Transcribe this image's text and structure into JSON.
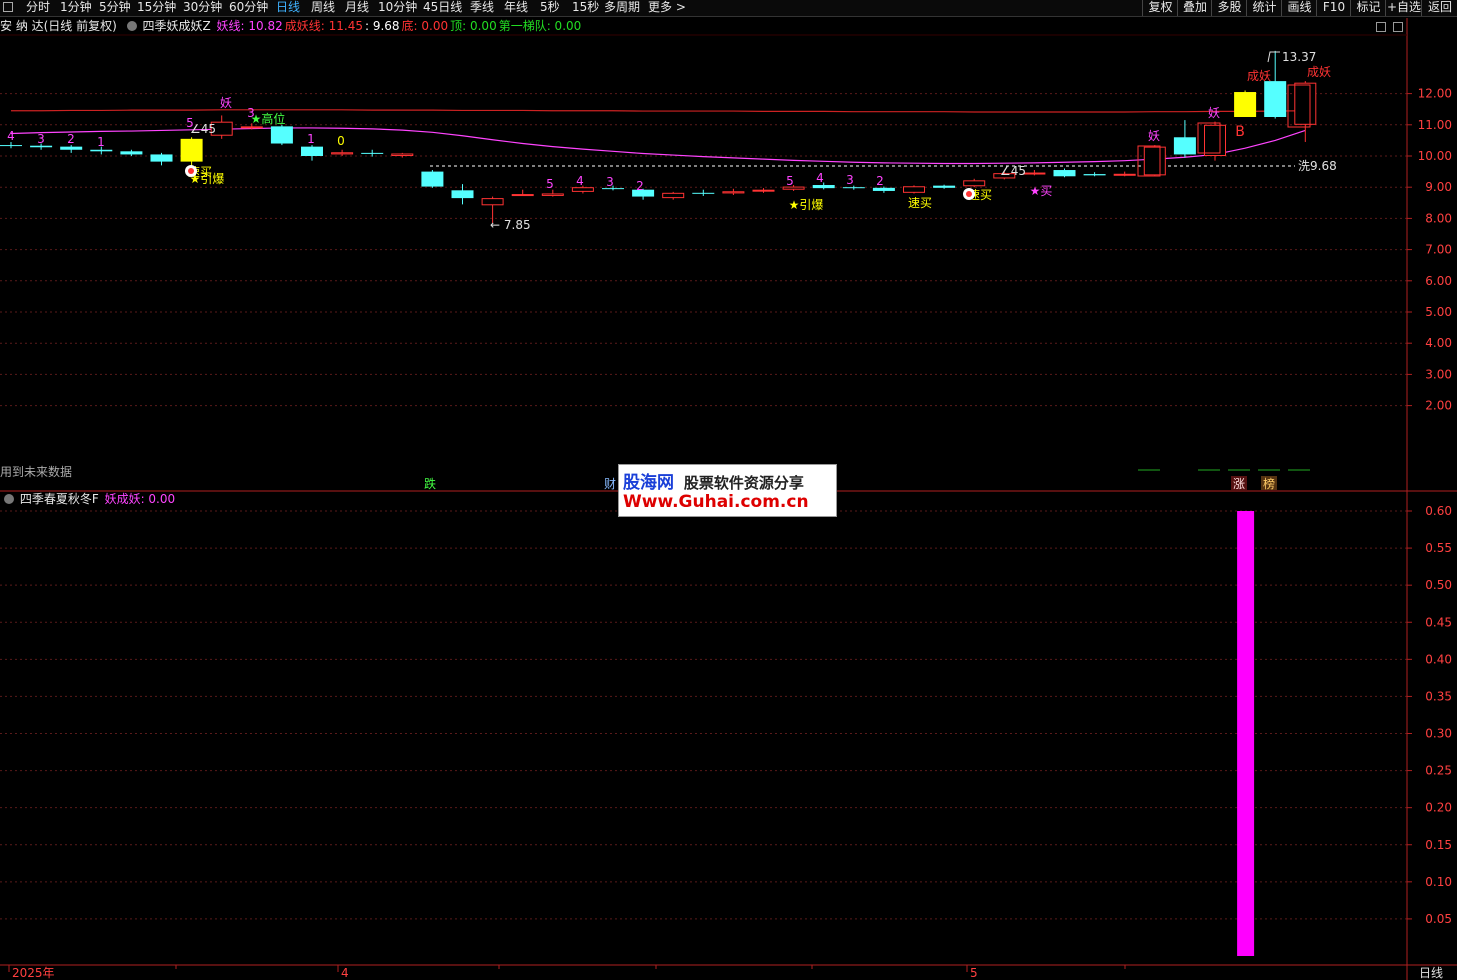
{
  "toolbar": {
    "items": [
      "分时",
      "1分钟",
      "5分钟",
      "15分钟",
      "30分钟",
      "60分钟",
      "日线",
      "周线",
      "月线",
      "10分钟",
      "45日线",
      "季线",
      "年线",
      "5秒",
      "15秒",
      "多周期",
      "更多 >"
    ],
    "active_index": 6,
    "right_items": [
      "复权",
      "叠加",
      "多股",
      "统计",
      "画线",
      "F10",
      "标记",
      "+自选",
      "返回"
    ]
  },
  "main_legend": {
    "stock_name": "安 纳 达(日线 前复权)",
    "indicator_name": "四季妖成妖Z",
    "items": [
      {
        "label": "妖线: 10.82",
        "color": "#ff44ff"
      },
      {
        "label": "成妖线: 11.45",
        "color": "#ff3333"
      },
      {
        "label": ": 9.68",
        "color": "#ffffff"
      },
      {
        "label": "底: 0.00",
        "color": "#ff3333"
      },
      {
        "label": "顶: 0.00",
        "color": "#22dd22"
      },
      {
        "label": "第一梯队: 0.00",
        "color": "#22dd22"
      }
    ]
  },
  "sub_legend": {
    "indicator_name": "四季春夏秋冬F",
    "items": [
      {
        "label": "妖成妖: 0.00",
        "color": "#ff44ff"
      }
    ]
  },
  "future_data_note": "用到未来数据",
  "main_axis": {
    "ticks": [
      "12.00",
      "11.00",
      "10.00",
      "9.00",
      "8.00",
      "7.00",
      "6.00",
      "5.00",
      "4.00",
      "3.00",
      "2.00"
    ]
  },
  "sub_axis": {
    "ticks": [
      "0.60",
      "0.55",
      "0.50",
      "0.45",
      "0.40",
      "0.35",
      "0.30",
      "0.25",
      "0.20",
      "0.15",
      "0.10",
      "0.05"
    ]
  },
  "date_axis": {
    "labels": [
      "2025年",
      "4",
      "5"
    ],
    "corner_label": "日线"
  },
  "price_annotations": {
    "high": "13.37",
    "low": "7.85",
    "wash": "洗9.68",
    "angle": "∠45"
  },
  "signals": {
    "yao": "妖",
    "chengyao": "成妖",
    "gaowei": "★高位",
    "yinbao": "★引爆",
    "susu": "速买",
    "star_buy": "★买",
    "b": "B",
    "die": "跌",
    "cai": "财",
    "zhang": "涨",
    "bang": "榜"
  },
  "counts_before": [
    "4",
    "3",
    "2",
    "1",
    "5",
    "3",
    "1",
    "0"
  ],
  "counts_mid": [
    "5",
    "4",
    "3",
    "2",
    "5",
    "4",
    "3",
    "2"
  ],
  "watermark": {
    "brand": "股海网",
    "slogan": "股票软件资源分享",
    "url": "Www.Guhai.com.cn"
  },
  "colors": {
    "up": "#ff3333",
    "down": "#55ffff",
    "yao": "#ff44ff",
    "chengyao": "#cc2222",
    "signal_yellow": "#ffff00",
    "bar_magenta": "#ff00ff"
  },
  "chart_data": {
    "type": "candlestick",
    "x_labels": [
      "2025年",
      "4",
      "5"
    ],
    "ylim": [
      1.5,
      13.5
    ],
    "candles": [
      {
        "o": 10.35,
        "c": 10.32,
        "h": 10.45,
        "l": 10.25
      },
      {
        "o": 10.33,
        "c": 10.28,
        "h": 10.4,
        "l": 10.2
      },
      {
        "o": 10.3,
        "c": 10.2,
        "h": 10.35,
        "l": 10.1
      },
      {
        "o": 10.2,
        "c": 10.15,
        "h": 10.3,
        "l": 10.05
      },
      {
        "o": 10.15,
        "c": 10.05,
        "h": 10.2,
        "l": 10.0
      },
      {
        "o": 10.05,
        "c": 9.82,
        "h": 10.1,
        "l": 9.7
      },
      {
        "o": 10.55,
        "c": 9.82,
        "h": 10.6,
        "l": 9.7,
        "signal": "yellow"
      },
      {
        "o": 10.65,
        "c": 11.1,
        "h": 11.3,
        "l": 10.55
      },
      {
        "o": 10.9,
        "c": 10.95,
        "h": 11.05,
        "l": 10.85
      },
      {
        "o": 10.95,
        "c": 10.4,
        "h": 11.0,
        "l": 10.35
      },
      {
        "o": 10.3,
        "c": 10.0,
        "h": 10.35,
        "l": 9.85
      },
      {
        "o": 10.05,
        "c": 10.12,
        "h": 10.2,
        "l": 10.0
      },
      {
        "o": 10.1,
        "c": 10.08,
        "h": 10.2,
        "l": 9.98
      },
      {
        "o": 10.0,
        "c": 10.08,
        "h": 10.1,
        "l": 9.95
      },
      {
        "o": 9.5,
        "c": 9.02,
        "h": 9.55,
        "l": 8.98
      },
      {
        "o": 8.9,
        "c": 8.65,
        "h": 9.1,
        "l": 8.45
      },
      {
        "o": 8.42,
        "c": 8.65,
        "h": 8.7,
        "l": 7.85
      },
      {
        "o": 8.78,
        "c": 8.78,
        "h": 8.92,
        "l": 8.72
      },
      {
        "o": 8.72,
        "c": 8.8,
        "h": 8.92,
        "l": 8.7
      },
      {
        "o": 8.85,
        "c": 9.0,
        "h": 9.05,
        "l": 8.8
      },
      {
        "o": 8.97,
        "c": 8.96,
        "h": 9.05,
        "l": 8.9
      },
      {
        "o": 8.92,
        "c": 8.7,
        "h": 8.95,
        "l": 8.6
      },
      {
        "o": 8.65,
        "c": 8.82,
        "h": 8.85,
        "l": 8.6
      },
      {
        "o": 8.82,
        "c": 8.8,
        "h": 8.92,
        "l": 8.72
      },
      {
        "o": 8.8,
        "c": 8.87,
        "h": 8.95,
        "l": 8.75
      },
      {
        "o": 8.87,
        "c": 8.92,
        "h": 8.97,
        "l": 8.82
      },
      {
        "o": 8.92,
        "c": 9.02,
        "h": 9.07,
        "l": 8.88
      },
      {
        "o": 9.07,
        "c": 8.97,
        "h": 9.15,
        "l": 8.93
      },
      {
        "o": 9.0,
        "c": 8.97,
        "h": 9.05,
        "l": 8.92
      },
      {
        "o": 8.98,
        "c": 8.88,
        "h": 9.02,
        "l": 8.82
      },
      {
        "o": 8.82,
        "c": 9.03,
        "h": 9.06,
        "l": 8.8
      },
      {
        "o": 9.05,
        "c": 8.98,
        "h": 9.08,
        "l": 8.95
      },
      {
        "o": 9.03,
        "c": 9.22,
        "h": 9.27,
        "l": 9.0
      },
      {
        "o": 9.28,
        "c": 9.45,
        "h": 9.5,
        "l": 9.25
      },
      {
        "o": 9.45,
        "c": 9.47,
        "h": 9.55,
        "l": 9.38
      },
      {
        "o": 9.55,
        "c": 9.35,
        "h": 9.6,
        "l": 9.32
      },
      {
        "o": 9.42,
        "c": 9.38,
        "h": 9.48,
        "l": 9.35
      },
      {
        "o": 9.4,
        "c": 9.43,
        "h": 9.5,
        "l": 9.35
      },
      {
        "o": 9.38,
        "c": 10.3,
        "h": 10.35,
        "l": 9.35
      },
      {
        "o": 10.6,
        "c": 10.05,
        "h": 11.15,
        "l": 9.95
      },
      {
        "o": 10.0,
        "c": 11.0,
        "h": 11.1,
        "l": 9.85
      },
      {
        "o": 11.25,
        "c": 12.05,
        "h": 12.1,
        "l": 11.25,
        "signal": "yellow"
      },
      {
        "o": 12.4,
        "c": 11.25,
        "h": 13.37,
        "l": 11.2
      },
      {
        "o": 11.0,
        "c": 12.35,
        "h": 12.4,
        "l": 10.45
      }
    ],
    "yao_line": [
      10.72,
      10.75,
      10.77,
      10.79,
      10.8,
      10.82,
      10.84,
      10.86,
      10.88,
      10.9,
      10.9,
      10.89,
      10.87,
      10.83,
      10.76,
      10.65,
      10.52,
      10.4,
      10.3,
      10.22,
      10.15,
      10.08,
      10.03,
      9.98,
      9.94,
      9.9,
      9.86,
      9.83,
      9.8,
      9.78,
      9.77,
      9.76,
      9.76,
      9.77,
      9.78,
      9.8,
      9.82,
      9.85,
      9.9,
      9.96,
      10.05,
      10.25,
      10.5,
      10.82
    ],
    "chengyao_line": [
      11.45,
      11.45,
      11.46,
      11.46,
      11.47,
      11.47,
      11.47,
      11.48,
      11.48,
      11.48,
      11.48,
      11.48,
      11.47,
      11.47,
      11.47,
      11.46,
      11.46,
      11.46,
      11.45,
      11.45,
      11.45,
      11.44,
      11.44,
      11.44,
      11.44,
      11.43,
      11.43,
      11.43,
      11.42,
      11.42,
      11.42,
      11.42,
      11.41,
      11.41,
      11.41,
      11.41,
      11.41,
      11.41,
      11.42,
      11.42,
      11.43,
      11.43,
      11.44,
      11.45
    ],
    "wash_level": 9.68,
    "sub_series": {
      "name": "妖成妖",
      "values": [
        0,
        0,
        0,
        0,
        0,
        0,
        0,
        0,
        0,
        0,
        0,
        0,
        0,
        0,
        0,
        0,
        0,
        0,
        0,
        0,
        0,
        0,
        0,
        0,
        0,
        0,
        0,
        0,
        0,
        0,
        0,
        0,
        0,
        0,
        0,
        0,
        0,
        0,
        0,
        0,
        0,
        0.6,
        0,
        0
      ],
      "ylim": [
        0,
        0.62
      ]
    }
  }
}
